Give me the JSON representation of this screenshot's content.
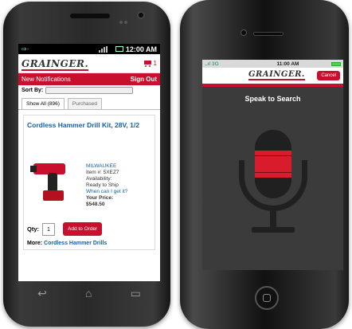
{
  "android": {
    "status": {
      "left": "⇨·",
      "time": "12:00 AM"
    },
    "header": {
      "logo": "GRAINGER.",
      "cart_count": "1"
    },
    "notif": {
      "left": "New Notifications",
      "right": "Sign Out"
    },
    "sort_label": "Sort By:",
    "tabs": [
      "Show All (896)",
      "Purchased"
    ],
    "product": {
      "title": "Cordless Hammer Drill Kit, 28V, 1/2",
      "brand": "MILWAUKEE",
      "item": "Item #: 5XEZ7",
      "availability_label": "Availability:",
      "availability": "Ready to Ship",
      "when_link": "When can I get it?",
      "price_label": "Your Price:",
      "price": "$548.50",
      "qty_label": "Qty:",
      "qty": "1",
      "add_button": "Add to Order",
      "more_label": "More:",
      "more_link": "Cordless Hammer Drills"
    }
  },
  "iphone": {
    "status": {
      "carrier": "..ıl 3G",
      "time": "11:00 AM"
    },
    "header": {
      "logo": "GRAINGER.",
      "cancel": "Cancel"
    },
    "speak_title": "Speak to Search",
    "mic_level": 0.4
  },
  "colors": {
    "brand_red": "#c8102e",
    "link_blue": "#1060b0"
  }
}
